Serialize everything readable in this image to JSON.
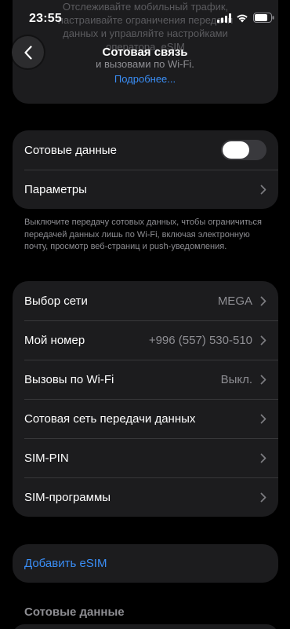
{
  "status_bar": {
    "time": "23:55",
    "battery_level": 0.8
  },
  "header": {
    "title": "Сотовая связь",
    "subtitle_line1": "и вызовами по Wi-Fi.",
    "more_link": "Подробнее...",
    "ghost_text": "Отслеживайте мобильный трафик, настраивайте ограничения передачи данных и управляйте настройками оператора, eSIM"
  },
  "group1": {
    "rows": [
      {
        "label": "Сотовые данные",
        "toggle_on": false
      },
      {
        "label": "Параметры"
      }
    ]
  },
  "footer_note": "Выключите передачу сотовых данных, чтобы ограничиться передачей данных лишь по Wi-Fi, включая электронную почту, просмотр веб-страниц и push-уведомления.",
  "group2": {
    "rows": [
      {
        "label": "Выбор сети",
        "value": "MEGA"
      },
      {
        "label": "Мой номер",
        "value": "+996 (557) 530-510"
      },
      {
        "label": "Вызовы по Wi-Fi",
        "value": "Выкл."
      },
      {
        "label": "Сотовая сеть передачи данных",
        "value": ""
      },
      {
        "label": "SIM-PIN",
        "value": ""
      },
      {
        "label": "SIM-программы",
        "value": ""
      }
    ]
  },
  "add_esim": "Добавить eSIM",
  "section_header": "Сотовые данные",
  "colors": {
    "accent": "#3a8ef6",
    "card": "#1c1c1e",
    "background": "#000000",
    "secondary": "#8e8e93"
  }
}
